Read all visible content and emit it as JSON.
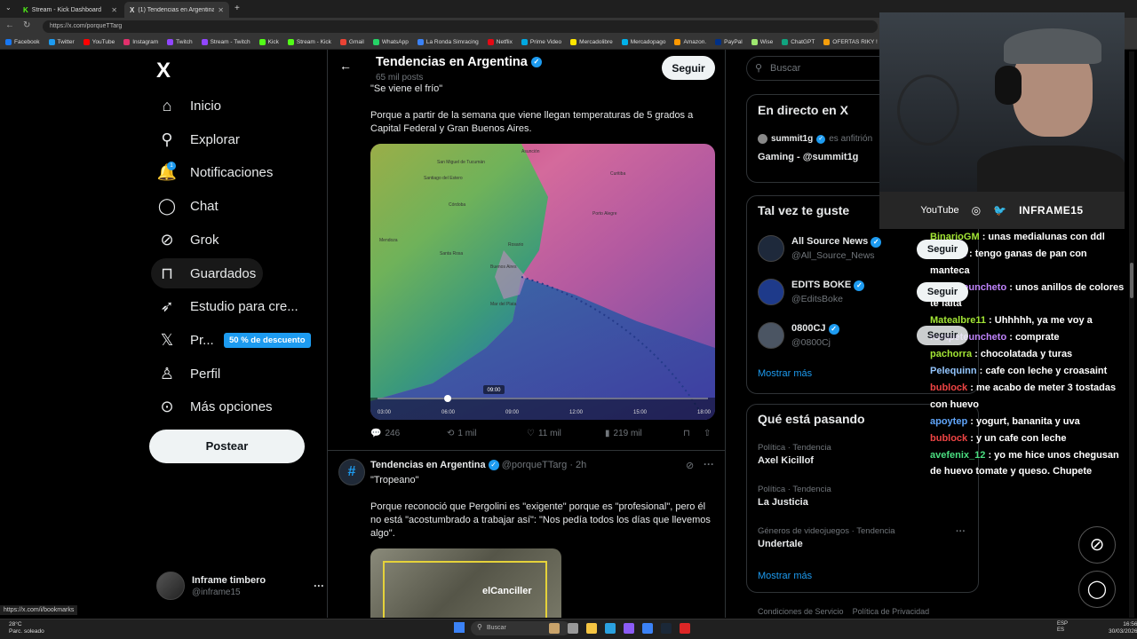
{
  "browser": {
    "tabs": [
      {
        "label": "Stream - Kick Dashboard",
        "icon": "kick-icon",
        "color": "#53fc18"
      },
      {
        "label": "(1) Tendencias en Argentina (@po…",
        "icon": "x-icon",
        "color": "#ffffff"
      }
    ],
    "url": "https://x.com/porqueTTarg",
    "bookmarks": [
      {
        "label": "Facebook",
        "color": "#1877f2"
      },
      {
        "label": "Twitter",
        "color": "#1d9bf0"
      },
      {
        "label": "YouTube",
        "color": "#ff0000"
      },
      {
        "label": "Instagram",
        "color": "#e1306c"
      },
      {
        "label": "Twitch",
        "color": "#9146ff"
      },
      {
        "label": "Stream - Twitch",
        "color": "#9146ff"
      },
      {
        "label": "Kick",
        "color": "#53fc18"
      },
      {
        "label": "Stream - Kick",
        "color": "#53fc18"
      },
      {
        "label": "Gmail",
        "color": "#ea4335"
      },
      {
        "label": "WhatsApp",
        "color": "#25d366"
      },
      {
        "label": "La Ronda Simracing",
        "color": "#3b82f6"
      },
      {
        "label": "Netflix",
        "color": "#e50914"
      },
      {
        "label": "Prime Video",
        "color": "#00a8e1"
      },
      {
        "label": "Mercadolibre",
        "color": "#ffe600"
      },
      {
        "label": "Mercadopago",
        "color": "#00b1ea"
      },
      {
        "label": "Amazon.",
        "color": "#ff9900"
      },
      {
        "label": "PayPal",
        "color": "#003087"
      },
      {
        "label": "Wise",
        "color": "#9fe870"
      },
      {
        "label": "ChatGPT",
        "color": "#10a37f"
      },
      {
        "label": "OFERTAS RIKY !",
        "color": "#f59e0b"
      }
    ],
    "status_url": "https://x.com/i/bookmarks"
  },
  "nav": {
    "logo": "X",
    "items": [
      {
        "label": "Inicio",
        "icon": "home-icon",
        "glyph": "⌂"
      },
      {
        "label": "Explorar",
        "icon": "search-icon",
        "glyph": "⚲"
      },
      {
        "label": "Notificaciones",
        "icon": "bell-icon",
        "glyph": "🔔"
      },
      {
        "label": "Chat",
        "icon": "chat-icon",
        "glyph": "◯"
      },
      {
        "label": "Grok",
        "icon": "grok-icon",
        "glyph": "⊘"
      },
      {
        "label": "Guardados",
        "icon": "bookmark-icon",
        "glyph": "⊓"
      },
      {
        "label": "Estudio para cre...",
        "icon": "rocket-icon",
        "glyph": "➶"
      },
      {
        "label": "Pr...",
        "icon": "x-premium-icon",
        "glyph": "𝕏"
      },
      {
        "label": "Perfil",
        "icon": "person-icon",
        "glyph": "♙"
      },
      {
        "label": "Más opciones",
        "icon": "more-circle-icon",
        "glyph": "⊙"
      }
    ],
    "notif_count": "1",
    "promo": "50 % de descuento",
    "post_button": "Postear",
    "profile": {
      "name": "Inframe timbero",
      "handle": "@inframe15",
      "more": "···"
    }
  },
  "header": {
    "title": "Tendencias en Argentina",
    "subtitle": "65 mil posts",
    "follow": "Seguir",
    "back": "←"
  },
  "post1": {
    "quote": "\"Se viene el frío\"",
    "body": "Porque a partir de la semana que viene llegan temperaturas de 5 grados a Capital Federal y Gran Buenos Aires.",
    "map_cities": [
      "San Miguel de Tucumán",
      "Santiago del Estero",
      "Córdoba",
      "Mendoza",
      "Santa Rosa",
      "Buenos Aires",
      "Mar del Plata",
      "Rosario",
      "Curitiba",
      "Porto Alegre",
      "Asunción"
    ],
    "map_times": [
      "03:00",
      "06:00",
      "09:00",
      "12:00",
      "15:00",
      "18:00"
    ],
    "map_current": "09:00",
    "replies": "246",
    "reposts": "1 mil",
    "likes": "11 mil",
    "views": "219 mil"
  },
  "post2": {
    "name": "Tendencias en Argentina",
    "handle": "@porqueTTarg",
    "time": "· 2h",
    "quote": "\"Tropeano\"",
    "body": "Porque reconoció que Pergolini es \"exigente\" porque es \"profesional\", pero él no está \"acostumbrado a trabajar así\": \"Nos pedía todos los días que llevemos algo\".",
    "image_caption": "elCanciller",
    "avatar_glyph": "#"
  },
  "right": {
    "search_placeholder": "Buscar",
    "live": {
      "title": "En directo en X",
      "host": "summit1g",
      "host_suffix": "es anfitrión",
      "space": "Gaming - @summit1g"
    },
    "suggest": {
      "title": "Tal vez te guste",
      "accounts": [
        {
          "name": "All Source News",
          "handle": "@All_Source_News",
          "color": "#1e293b"
        },
        {
          "name": "EDITS BOKE",
          "handle": "@EditsBoke",
          "color": "#1e3a8a"
        },
        {
          "name": "0800CJ",
          "handle": "@0800Cj",
          "color": "#4b5563"
        }
      ],
      "follow": "Seguir",
      "more": "Mostrar más"
    },
    "trends": {
      "title": "Qué está pasando",
      "items": [
        {
          "category": "Política · Tendencia",
          "name": "Axel Kicillof"
        },
        {
          "category": "Política · Tendencia",
          "name": "La Justicia"
        },
        {
          "category": "Géneros de videojuegos · Tendencia",
          "name": "Undertale"
        }
      ],
      "more": "Mostrar más"
    },
    "footer": [
      "Condiciones de Servicio",
      "Política de Privacidad"
    ]
  },
  "stream": {
    "socials": [
      "YouTube",
      "Instagram",
      "Twitter"
    ],
    "channel": "INFRAME15",
    "chat": [
      {
        "user": "BinarioGM",
        "msg": ": unas medialunas con ddl",
        "color": "#a3e635"
      },
      {
        "user": "Ladis22",
        "msg": ": tengo ganas de pan con manteca",
        "color": "#c084fc"
      },
      {
        "user": "rompeteuncheto",
        "msg": ": unos anillos de colores te falta",
        "color": "#c084fc"
      },
      {
        "user": "Matealbre11",
        "msg": ": Uhhhhh, ya me voy a",
        "color": "#a3e635"
      },
      {
        "user": "rompeteuncheto",
        "msg": ": comprate",
        "color": "#c084fc"
      },
      {
        "user": "pachorra",
        "msg": ": chocolatada y turas",
        "color": "#a3e635"
      },
      {
        "user": "Pelequinn",
        "msg": ": cafe con leche y croasaint",
        "color": "#93c5fd"
      },
      {
        "user": "bublock",
        "msg": ": me acabo de meter 3 tostadas con huevo",
        "color": "#ef4444"
      },
      {
        "user": "apoytep",
        "msg": ": yogurt, bananita y uva",
        "color": "#60a5fa"
      },
      {
        "user": "bublock",
        "msg": ": y un cafe con leche",
        "color": "#ef4444"
      },
      {
        "user": "avefenix_12",
        "msg": ": yo me hice unos chegusan de huevo tomate y queso. Chupete",
        "color": "#4ade80"
      }
    ]
  },
  "taskbar": {
    "weather_temp": "28°C",
    "weather_desc": "Parc. soleado",
    "search": "Buscar",
    "lang": "ESP",
    "lang2": "ES",
    "time": "16:56",
    "date": "30/03/2026"
  }
}
